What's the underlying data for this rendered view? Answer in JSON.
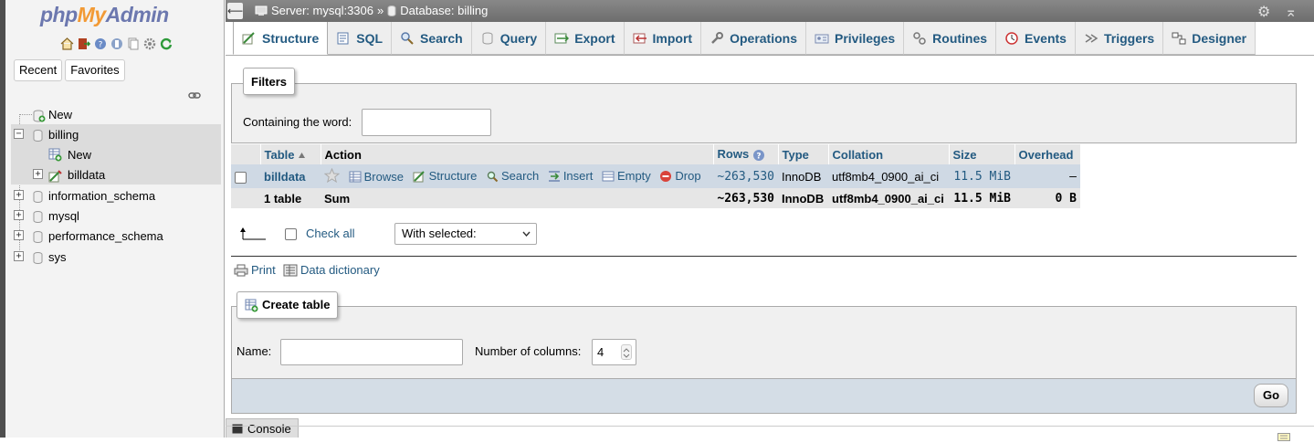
{
  "nav": {
    "logo_php": "php",
    "logo_my": "My",
    "logo_admin": "Admin",
    "tabs": [
      "Recent",
      "Favorites"
    ],
    "tree": {
      "new_top": "New",
      "billing": "billing",
      "billing_new": "New",
      "billdata": "billdata",
      "dbs": [
        "information_schema",
        "mysql",
        "performance_schema",
        "sys"
      ]
    }
  },
  "topbar": {
    "server": "Server: mysql:3306",
    "sep": "»",
    "database": "Database: billing"
  },
  "tabs": [
    {
      "label": "Structure",
      "icon": "structure-icon"
    },
    {
      "label": "SQL",
      "icon": "sql-icon"
    },
    {
      "label": "Search",
      "icon": "search-icon"
    },
    {
      "label": "Query",
      "icon": "query-icon"
    },
    {
      "label": "Export",
      "icon": "export-icon"
    },
    {
      "label": "Import",
      "icon": "import-icon"
    },
    {
      "label": "Operations",
      "icon": "wrench-icon"
    },
    {
      "label": "Privileges",
      "icon": "privileges-icon"
    },
    {
      "label": "Routines",
      "icon": "routines-icon"
    },
    {
      "label": "Events",
      "icon": "clock-icon"
    },
    {
      "label": "Triggers",
      "icon": "triggers-icon"
    },
    {
      "label": "Designer",
      "icon": "designer-icon"
    }
  ],
  "filters": {
    "legend": "Filters",
    "label": "Containing the word:",
    "value": ""
  },
  "table": {
    "headers": {
      "table": "Table",
      "action": "Action",
      "rows": "Rows",
      "type": "Type",
      "collation": "Collation",
      "size": "Size",
      "overhead": "Overhead"
    },
    "row": {
      "name": "billdata",
      "actions": [
        "Browse",
        "Structure",
        "Search",
        "Insert",
        "Empty",
        "Drop"
      ],
      "rows": "~263,530",
      "type": "InnoDB",
      "collation": "utf8mb4_0900_ai_ci",
      "size": "11.5 MiB",
      "overhead": "–"
    },
    "sum": {
      "name": "1 table",
      "label": "Sum",
      "rows": "~263,530",
      "type": "InnoDB",
      "collation": "utf8mb4_0900_ai_ci",
      "size": "11.5 MiB",
      "overhead": "0 B"
    }
  },
  "bulk": {
    "check_all": "Check all",
    "with_selected": "With selected:"
  },
  "links": {
    "print": "Print",
    "data_dictionary": "Data dictionary"
  },
  "create": {
    "legend": "Create table",
    "name_label": "Name:",
    "name_value": "",
    "cols_label": "Number of columns:",
    "cols_value": "4",
    "go": "Go"
  },
  "console": {
    "label": "Console"
  }
}
